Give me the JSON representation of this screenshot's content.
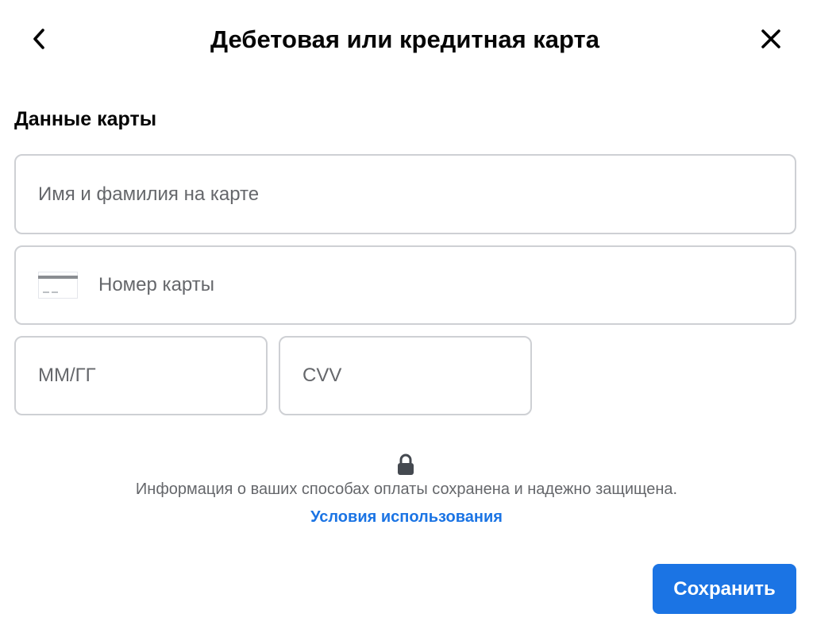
{
  "header": {
    "title": "Дебетовая или кредитная карта",
    "back_icon": "chevron-left-icon",
    "close_icon": "close-icon"
  },
  "form": {
    "section_title": "Данные карты",
    "fields": {
      "name": {
        "placeholder": "Имя и фамилия на карте",
        "value": ""
      },
      "number": {
        "placeholder": "Номер карты",
        "value": "",
        "icon": "credit-card-icon"
      },
      "expiry": {
        "placeholder": "ММ/ГГ",
        "value": ""
      },
      "cvv": {
        "placeholder": "CVV",
        "value": ""
      }
    }
  },
  "security": {
    "icon": "lock-icon",
    "info_text": "Информация о ваших способах оплаты сохранена и надежно защищена.",
    "terms_link": "Условия использования"
  },
  "actions": {
    "save_label": "Сохранить"
  },
  "colors": {
    "accent": "#1b74e4",
    "text_primary": "#050505",
    "text_secondary": "#65676b",
    "border": "#ced0d4"
  }
}
